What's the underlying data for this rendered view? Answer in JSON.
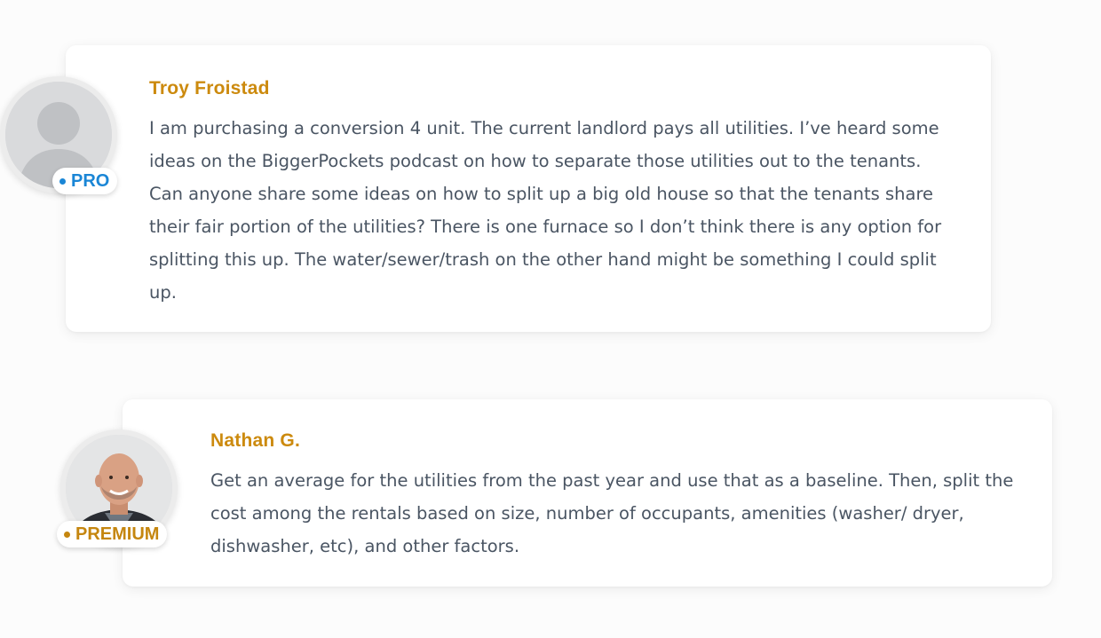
{
  "posts": [
    {
      "author": "Troy Froistad",
      "badge": "PRO",
      "body": "I am purchasing a conversion 4 unit. The current landlord pays all utilities. I’ve heard some ideas on the BiggerPockets podcast on how to separate those utilities out to the tenants. Can anyone share some ideas on how to split up a big old house so that the tenants share their fair portion of the utilities? There is one furnace so I don’t think there is any option for splitting this up. The water/sewer/trash on the other hand might be something I could split up.",
      "avatar": "default-user-icon"
    },
    {
      "author": "Nathan G.",
      "badge": "PREMIUM",
      "body": "Get an average for the utilities from the past year and use that as a baseline. Then, split the cost among the rentals based on size, number of occupants, amenities (washer/ dryer, dishwasher, etc), and other factors.",
      "avatar": "user-photo"
    }
  ],
  "colors": {
    "author": "#cc8a0e",
    "pro": "#1a86d6",
    "premium": "#c5860f",
    "body_text": "#4a5563"
  }
}
